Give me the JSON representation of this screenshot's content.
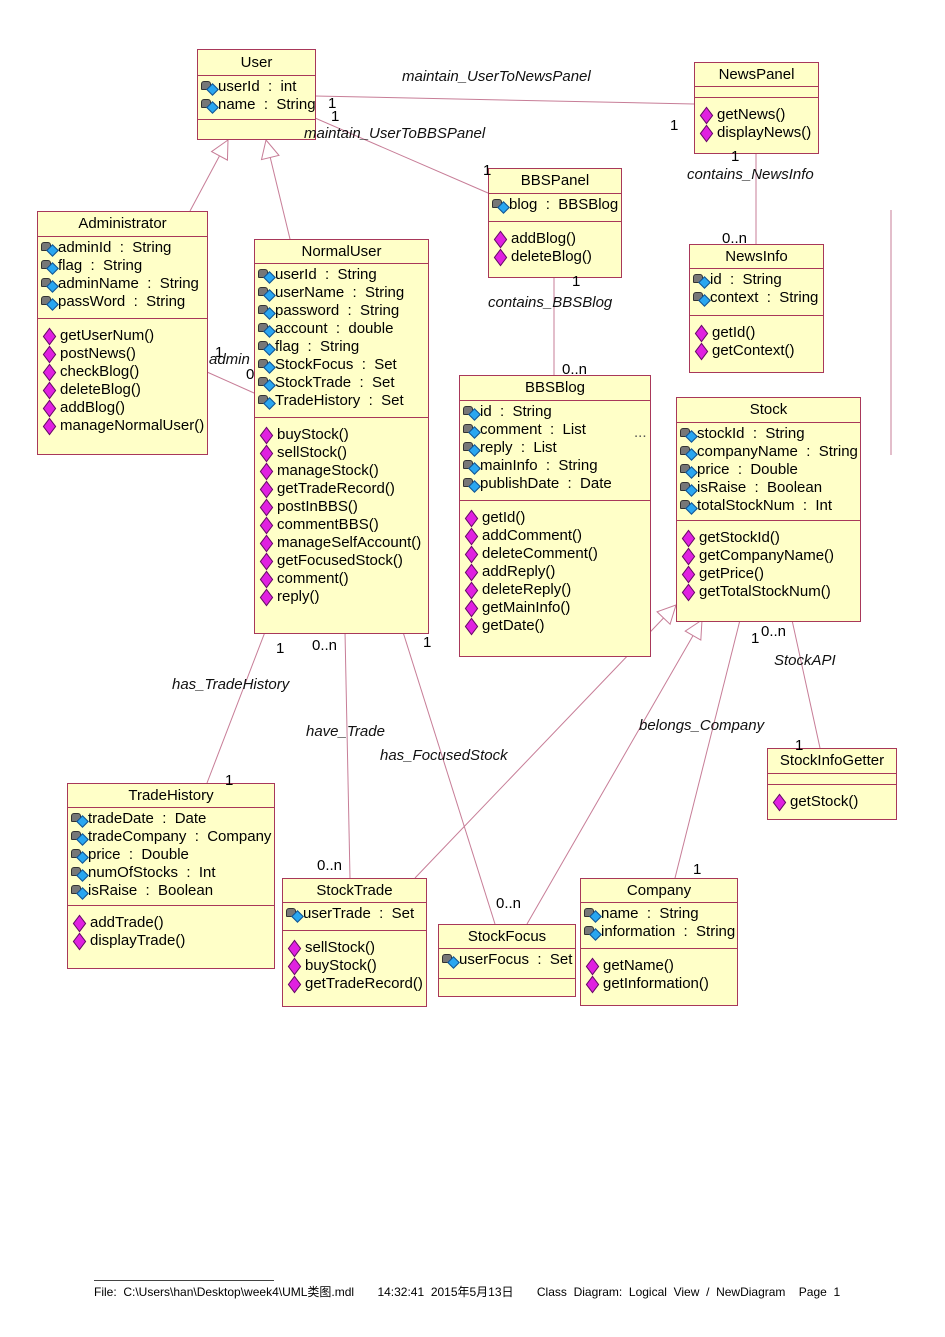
{
  "colors": {
    "class_fill": "#ffffc8",
    "class_border": "#a8385a",
    "line": "#c77d97",
    "method_icon": "#e020e0",
    "attr_icon": "#29a6f0"
  },
  "classes": [
    {
      "name": "User",
      "attributes": [
        "userId  :  int",
        "name  :  String"
      ],
      "operations": []
    },
    {
      "name": "NewsPanel",
      "attributes": [],
      "operations": [
        "getNews()",
        "displayNews()"
      ]
    },
    {
      "name": "Administrator",
      "attributes": [
        "adminId  :  String",
        "flag  :  String",
        "adminName  :  String",
        "passWord  :  String"
      ],
      "operations": [
        "getUserNum()",
        "postNews()",
        "checkBlog()",
        "deleteBlog()",
        "addBlog()",
        "manageNormalUser()"
      ]
    },
    {
      "name": "NormalUser",
      "attributes": [
        "userId  :  String",
        "userName  :  String",
        "password  :  String",
        "account  :  double",
        "flag  :  String",
        "StockFocus  :  Set",
        "StockTrade  :  Set",
        "TradeHistory  :  Set"
      ],
      "operations": [
        "buyStock()",
        "sellStock()",
        "manageStock()",
        "getTradeRecord()",
        "postInBBS()",
        "commentBBS()",
        "manageSelfAccount()",
        "getFocusedStock()",
        "comment()",
        "reply()"
      ]
    },
    {
      "name": "BBSPanel",
      "attributes": [
        "blog  :  BBSBlog"
      ],
      "operations": [
        "addBlog()",
        "deleteBlog()"
      ]
    },
    {
      "name": "NewsInfo",
      "attributes": [
        "id  :  String",
        "context  :  String"
      ],
      "operations": [
        "getId()",
        "getContext()"
      ]
    },
    {
      "name": "BBSBlog",
      "attributes": [
        "id  :  String",
        "comment  :  List",
        "reply  :  List",
        "mainInfo  :  String",
        "publishDate  :  Date"
      ],
      "operations": [
        "getId()",
        "addComment()",
        "deleteComment()",
        "addReply()",
        "deleteReply()",
        "getMainInfo()",
        "getDate()"
      ]
    },
    {
      "name": "Stock",
      "attributes": [
        "stockId  :  String",
        "companyName  :  String",
        "price  :  Double",
        "isRaise  :  Boolean",
        "totalStockNum  :  Int"
      ],
      "operations": [
        "getStockId()",
        "getCompanyName()",
        "getPrice()",
        "getTotalStockNum()"
      ]
    },
    {
      "name": "StockInfoGetter",
      "attributes": [],
      "operations": [
        "getStock()"
      ]
    },
    {
      "name": "TradeHistory",
      "attributes": [
        "tradeDate  :  Date",
        "tradeCompany  :  Company",
        "price  :  Double",
        "numOfStocks  :  Int",
        "isRaise  :  Boolean"
      ],
      "operations": [
        "addTrade()",
        "displayTrade()"
      ]
    },
    {
      "name": "StockTrade",
      "attributes": [
        "userTrade  :  Set"
      ],
      "operations": [
        "sellStock()",
        "buyStock()",
        "getTradeRecord()"
      ]
    },
    {
      "name": "StockFocus",
      "attributes": [
        "userFocus  :  Set"
      ],
      "operations": []
    },
    {
      "name": "Company",
      "attributes": [
        "name  :  String",
        "information  :  String"
      ],
      "operations": [
        "getName()",
        "getInformation()"
      ]
    }
  ],
  "associations": {
    "maintain_user_news": "maintain_UserToNewsPanel",
    "maintain_user_bbs": "maintain_UserToBBSPanel",
    "contains_news": "contains_NewsInfo",
    "contains_bbs": "contains_BBSBlog",
    "admin": "admin",
    "has_trade_history": "has_TradeHistory",
    "have_trade": "have_Trade",
    "has_focused_stock": "has_FocusedStock",
    "belongs_company": "belongs_Company",
    "stock_api": "StockAPI"
  },
  "multiplicities": {
    "one": "1",
    "zero": "0",
    "zero_n": "0..n",
    "ellipsis": "..."
  },
  "footer": {
    "file": "File:  C:\\Users\\han\\Desktop\\week4\\UML类图.mdl",
    "time": "14:32:41  2015年5月13日",
    "diagram": "Class  Diagram:  Logical  View  /  NewDiagram",
    "page": "Page  1"
  }
}
